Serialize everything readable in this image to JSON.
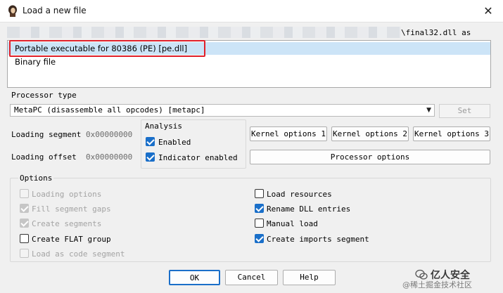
{
  "window": {
    "title": "Load a new file",
    "close_glyph": "✕"
  },
  "file": {
    "path_suffix": "\\final32.dll as"
  },
  "formats": [
    {
      "label": "Portable executable for 80386 (PE) [pe.dll]",
      "selected": true
    },
    {
      "label": "Binary file",
      "selected": false
    }
  ],
  "processor": {
    "label": "Processor type",
    "value": "MetaPC (disassemble all opcodes) [metapc]",
    "set_label": "Set"
  },
  "loading": {
    "segment_label": "Loading segment",
    "segment_value": "0x00000000",
    "offset_label": "Loading offset",
    "offset_value": "0x00000000"
  },
  "analysis": {
    "title": "Analysis",
    "enabled_label": "Enabled",
    "enabled_checked": true,
    "indicator_label": "Indicator enabled",
    "indicator_checked": true
  },
  "kernel_buttons": [
    "Kernel options 1",
    "Kernel options 2",
    "Kernel options 3"
  ],
  "processor_options_label": "Processor options",
  "options": {
    "title": "Options",
    "left": [
      {
        "label": "Loading options",
        "checked": false,
        "disabled": true
      },
      {
        "label": "Fill segment gaps",
        "checked": true,
        "disabled": true
      },
      {
        "label": "Create segments",
        "checked": true,
        "disabled": true
      },
      {
        "label": "Create FLAT group",
        "checked": false,
        "disabled": false
      },
      {
        "label": "Load as code segment",
        "checked": false,
        "disabled": true
      }
    ],
    "right": [
      {
        "label": "Load resources",
        "checked": false,
        "disabled": false
      },
      {
        "label": "Rename DLL entries",
        "checked": true,
        "disabled": false
      },
      {
        "label": "Manual load",
        "checked": false,
        "disabled": false
      },
      {
        "label": "Create imports segment",
        "checked": true,
        "disabled": false
      }
    ]
  },
  "footer": {
    "ok_label": "OK",
    "cancel_label": "Cancel",
    "help_label": "Help"
  },
  "watermark": {
    "brand": "亿人安全",
    "site": "@稀土掘金技术社区"
  },
  "colors": {
    "accent": "#1a6fc9",
    "selection": "#cce4f7",
    "highlight": "#e0202a"
  }
}
